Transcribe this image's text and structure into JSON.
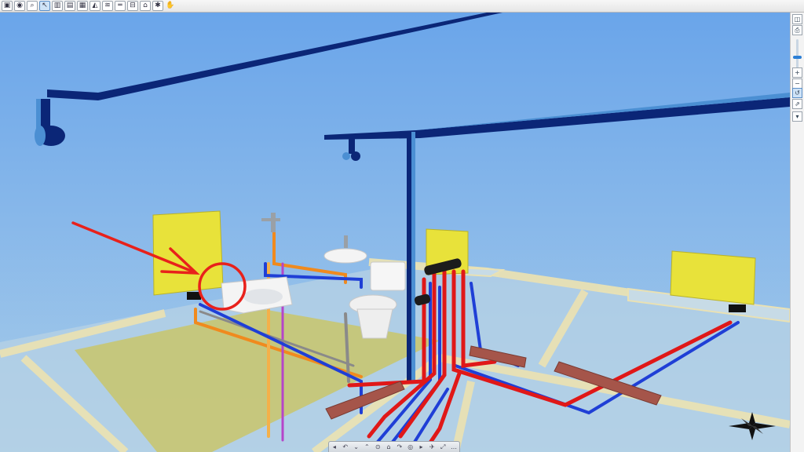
{
  "toolbar": {
    "buttons": [
      {
        "name": "view-3d-icon",
        "glyph": "▣"
      },
      {
        "name": "render-icon",
        "glyph": "◉"
      },
      {
        "name": "zoom-window-icon",
        "glyph": "⌕"
      },
      {
        "name": "select-pointer-icon",
        "glyph": "↖"
      },
      {
        "name": "building-icon",
        "glyph": "▥"
      },
      {
        "name": "floor-plan-icon",
        "glyph": "▤"
      },
      {
        "name": "section-icon",
        "glyph": "▦"
      },
      {
        "name": "roof-icon",
        "glyph": "◭"
      },
      {
        "name": "layers-icon",
        "glyph": "≋"
      },
      {
        "name": "pipe-icon",
        "glyph": "═"
      },
      {
        "name": "duct-icon",
        "glyph": "⊟"
      },
      {
        "name": "fixture-icon",
        "glyph": "⌂"
      },
      {
        "name": "settings-icon",
        "glyph": "✱"
      },
      {
        "name": "hand-pan-icon",
        "glyph": "✋"
      }
    ]
  },
  "sidepanel": {
    "buttons": [
      {
        "name": "view-cube-icon",
        "glyph": "◫"
      },
      {
        "name": "print-icon",
        "glyph": "⎙"
      },
      {
        "name": "zoom-in-icon",
        "glyph": "+"
      },
      {
        "name": "zoom-out-icon",
        "glyph": "−"
      },
      {
        "name": "orbit-icon",
        "glyph": "↺"
      },
      {
        "name": "walk-icon",
        "glyph": "⇗"
      },
      {
        "name": "visibility-icon",
        "glyph": "▾"
      }
    ],
    "zoom_level": 0.5
  },
  "navigation": {
    "buttons": [
      {
        "name": "pan-left-icon",
        "glyph": "◂"
      },
      {
        "name": "rotate-left-icon",
        "glyph": "↶"
      },
      {
        "name": "tilt-down-icon",
        "glyph": "⌄"
      },
      {
        "name": "tilt-up-icon",
        "glyph": "⌃"
      },
      {
        "name": "zoom-icon",
        "glyph": "⊙"
      },
      {
        "name": "home-view-icon",
        "glyph": "⌂"
      },
      {
        "name": "rotate-right-icon",
        "glyph": "↷"
      },
      {
        "name": "look-icon",
        "glyph": "◎"
      },
      {
        "name": "pan-right-icon",
        "glyph": "▸"
      },
      {
        "name": "fly-icon",
        "glyph": "✈"
      },
      {
        "name": "fit-icon",
        "glyph": "⤢"
      },
      {
        "name": "more-icon",
        "glyph": "…"
      }
    ]
  },
  "scene": {
    "colors": {
      "sky_top": "#6aa5ea",
      "sky_bottom": "#a9cde9",
      "cold_water": "#1f3fd6",
      "hot_water": "#e01818",
      "drain": "#f08a1e",
      "duct_dark": "#0b2677",
      "duct_light": "#4b8fd3",
      "radiator": "#e8e23a",
      "floor_panel": "#c9c56a",
      "wall_line": "#e9e1b4",
      "annotation": "#e8211b"
    }
  }
}
